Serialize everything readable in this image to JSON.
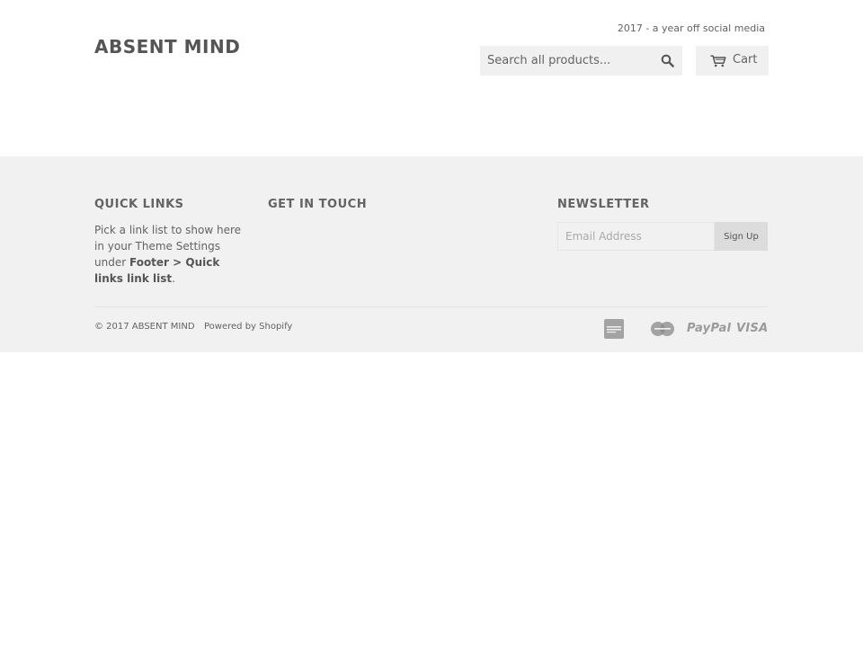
{
  "header": {
    "logo": "ABSENT MIND",
    "tagline": "2017 - a year off social media",
    "search": {
      "placeholder": "Search all products..."
    },
    "cart_label": "Cart"
  },
  "footer": {
    "quick_links": {
      "title": "QUICK LINKS",
      "text_before": "Pick a link list to show here in your Theme Settings under",
      "text_bold": "Footer > Quick links link list",
      "text_after": "."
    },
    "get_in_touch": {
      "title": "GET IN TOUCH"
    },
    "newsletter": {
      "title": "NEWSLETTER",
      "placeholder": "Email Address",
      "button_label": "Sign Up"
    },
    "copyright": "© 2017 ABSENT MIND",
    "powered_by": "Powered by Shopify",
    "payment_icons": [
      {
        "name": "american-express-icon"
      },
      {
        "name": "mastercard-icon"
      },
      {
        "name": "paypal-icon",
        "label": "PayPal"
      },
      {
        "name": "visa-icon",
        "label": "VISA"
      }
    ]
  }
}
